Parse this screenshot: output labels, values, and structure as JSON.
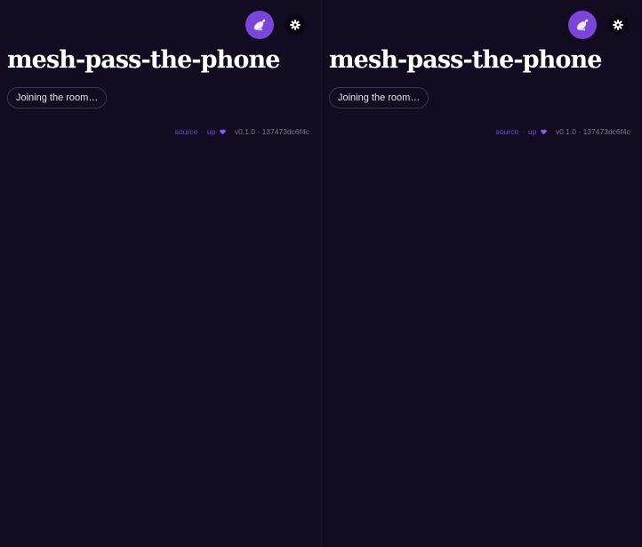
{
  "colors": {
    "background": "#120b21",
    "accent": "#7a45d8",
    "link": "#6d4fc4",
    "muted_text": "#7d7890"
  },
  "panes": [
    {
      "avatar_icon": "satellite-dish-icon",
      "settings_icon": "gear-icon",
      "title": "mesh-pass-the-phone",
      "status": "Joining the room…",
      "footer": {
        "source_label": "source",
        "separator": "·",
        "up_label": "up",
        "heart_icon": "purple-heart-icon",
        "version": "v0.1.0 · 137473dc6f4c"
      }
    },
    {
      "avatar_icon": "satellite-dish-icon",
      "settings_icon": "gear-icon",
      "title": "mesh-pass-the-phone",
      "status": "Joining the room…",
      "footer": {
        "source_label": "source",
        "separator": "·",
        "up_label": "up",
        "heart_icon": "purple-heart-icon",
        "version": "v0.1.0 · 137473dc6f4c"
      }
    }
  ]
}
